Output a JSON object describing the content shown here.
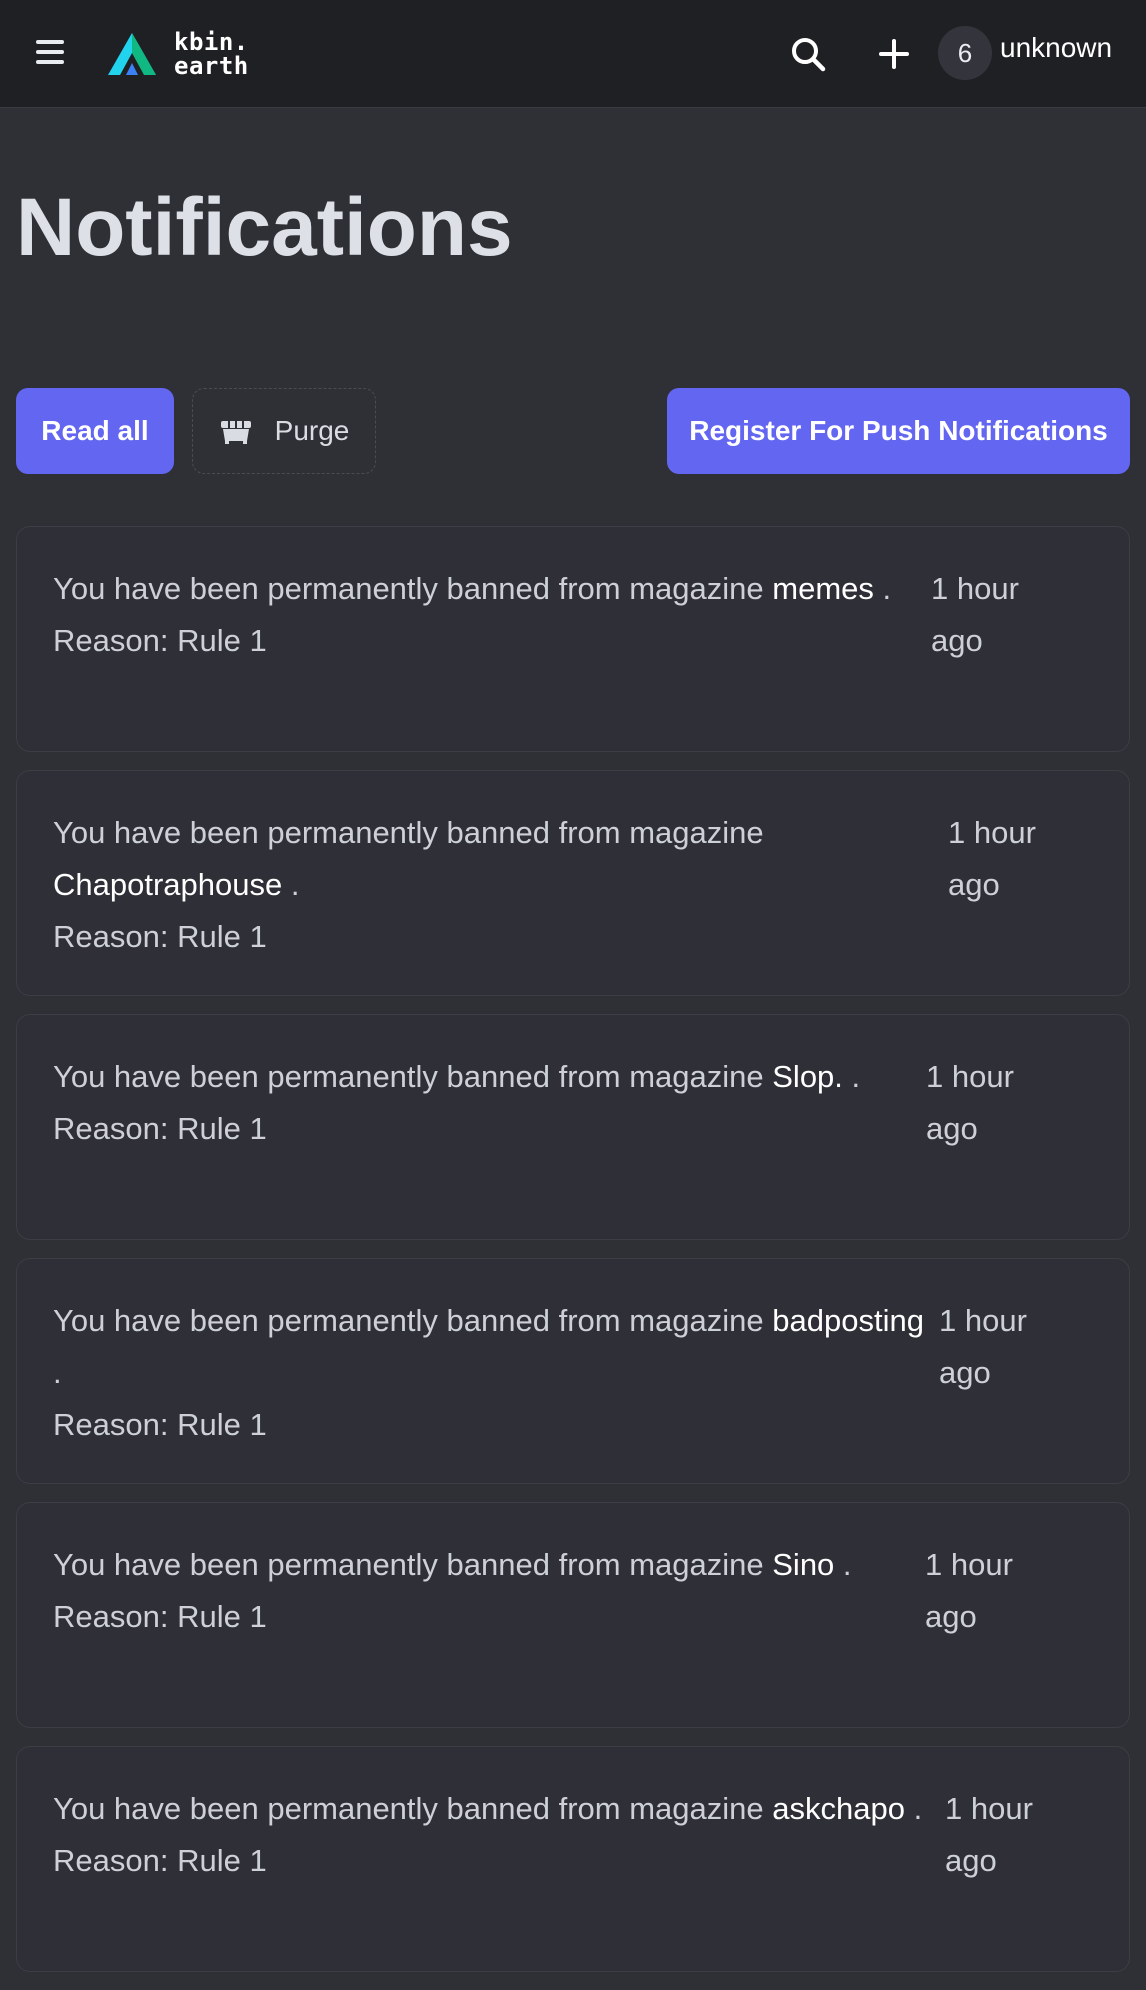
{
  "header": {
    "logo_line1": "kbin.",
    "logo_line2": "earth",
    "notification_count": "6",
    "username": "unknown"
  },
  "page": {
    "title": "Notifications"
  },
  "actions": {
    "read_all": "Read all",
    "purge": "Purge",
    "register_push": "Register For Push Notifications"
  },
  "colors": {
    "accent": "#6366f1",
    "topbar": "#1f2024",
    "background": "#2f3036"
  },
  "notifications": [
    {
      "prefix": "You have been permanently banned from magazine",
      "magazine": "memes",
      "suffix": " .",
      "reason": "Reason: Rule 1",
      "time": "1 hour ago"
    },
    {
      "prefix": "You have been permanently banned from magazine",
      "magazine": "Chapotraphouse",
      "suffix": " .",
      "reason": "Reason: Rule 1",
      "time": "1 hour ago"
    },
    {
      "prefix": "You have been permanently banned from magazine",
      "magazine": "Slop.",
      "suffix": " .",
      "reason": "Reason: Rule 1",
      "time": "1 hour ago"
    },
    {
      "prefix": "You have been permanently banned from magazine",
      "magazine": "badposting",
      "suffix": " .",
      "reason": "Reason: Rule 1",
      "time": "1 hour ago"
    },
    {
      "prefix": "You have been permanently banned from magazine",
      "magazine": "Sino",
      "suffix": " .",
      "reason": "Reason: Rule 1",
      "time": "1 hour ago"
    },
    {
      "prefix": "You have been permanently banned from magazine",
      "magazine": "askchapo",
      "suffix": " .",
      "reason": "Reason: Rule 1",
      "time": "1 hour ago"
    }
  ]
}
